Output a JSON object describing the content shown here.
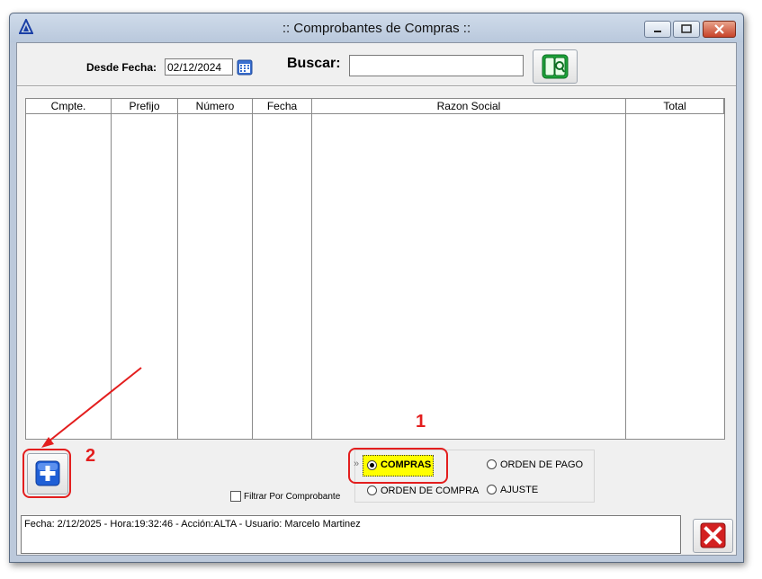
{
  "window": {
    "title": ":: Comprobantes de Compras ::",
    "app_logo_icon": "delta-triangle-icon",
    "minimize_icon": "minimize-icon",
    "maximize_icon": "maximize-icon",
    "close_icon": "close-icon"
  },
  "toolbar": {
    "desde_fecha_label": "Desde Fecha:",
    "desde_fecha_value": "02/12/2024",
    "calendar_icon": "calendar-icon",
    "buscar_label": "Buscar:",
    "buscar_value": "",
    "search_button_icon": "search-book-icon"
  },
  "grid": {
    "columns": [
      "Cmpte.",
      "Prefijo",
      "Número",
      "Fecha",
      "Razon Social",
      "Total"
    ],
    "rows": []
  },
  "actions": {
    "add_icon": "plus-icon",
    "filter_label": "Filtrar Por Comprobante",
    "filter_checked": false
  },
  "radio": {
    "options": [
      "COMPRAS",
      "ORDEN DE PAGO",
      "ORDEN DE COMPRA",
      "AJUSTE"
    ],
    "selected": "COMPRAS",
    "marker": "»"
  },
  "annotations": {
    "label_1": "1",
    "label_2": "2",
    "color": "#e31e1e"
  },
  "status": {
    "text": "Fecha: 2/12/2025 - Hora:19:32:46 - Acción:ALTA - Usuario: Marcelo Martinez"
  },
  "close_button_icon": "close-x-icon",
  "colors": {
    "titlebar": "#c4d2e4",
    "client_bg": "#f0f0f0",
    "highlight_yellow": "#ffff00",
    "add_button_blue": "#1f5fd6",
    "close_red": "#d32020"
  }
}
